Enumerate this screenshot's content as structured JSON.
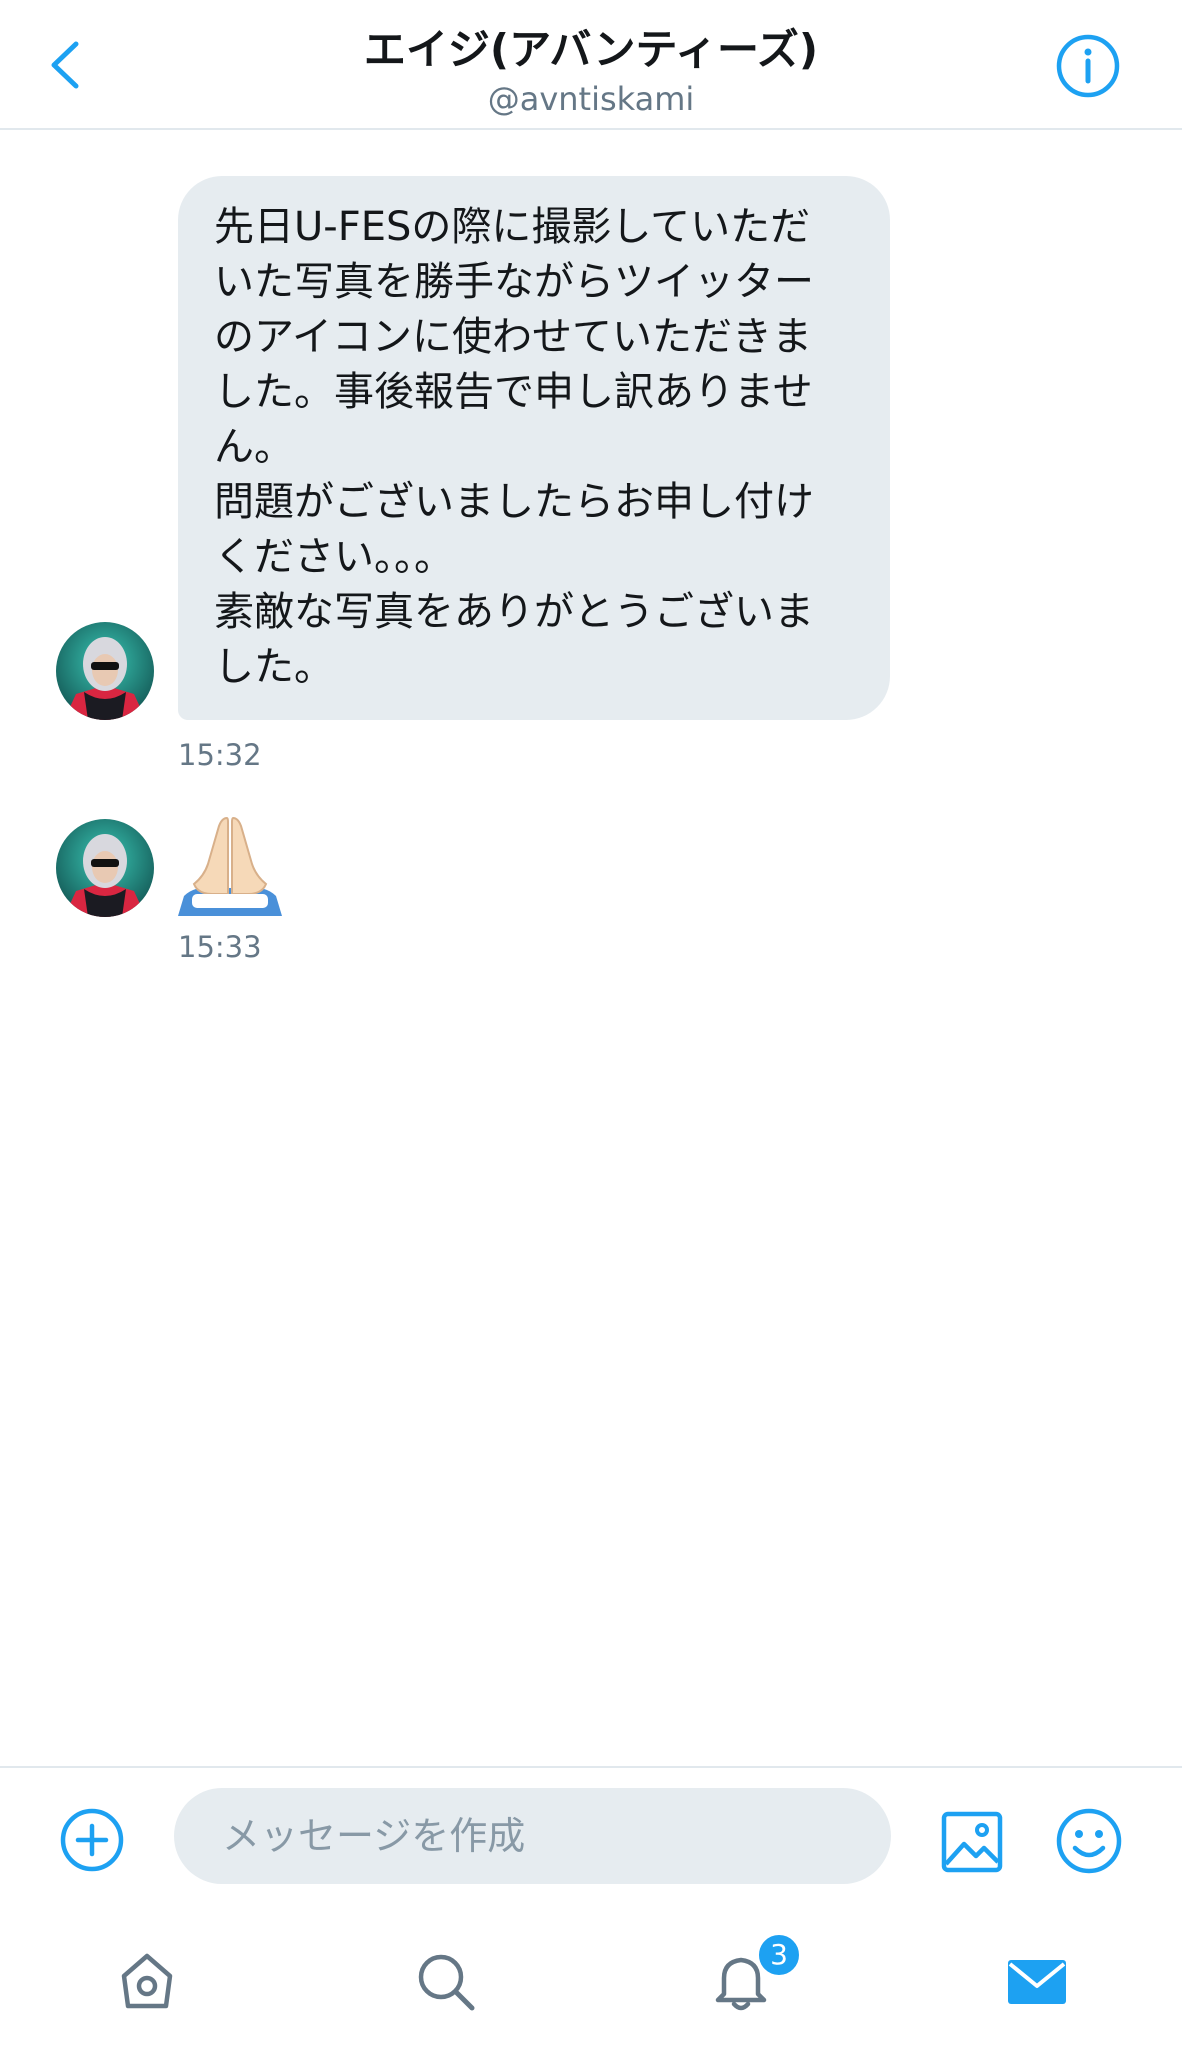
{
  "header": {
    "title": "エイジ(アバンティーズ)",
    "handle": "@avntiskami"
  },
  "messages": [
    {
      "text": "先日U-FESの際に撮影していただ\nいた写真を勝手ながらツイッター\nのアイコンに使わせていただきま\nした。事後報告で申し訳ありませ\nん。\n問題がございましたらお申し付け\nください。。。\n素敵な写真をありがとうございま\nした。",
      "time": "15:32"
    },
    {
      "emoji": "folded-hands",
      "time": "15:33"
    }
  ],
  "composer": {
    "placeholder": "メッセージを作成"
  },
  "tabbar": {
    "notifications_badge": "3"
  },
  "colors": {
    "accent": "#1da1f2",
    "bubble": "#e6ecf0",
    "muted": "#657786"
  }
}
